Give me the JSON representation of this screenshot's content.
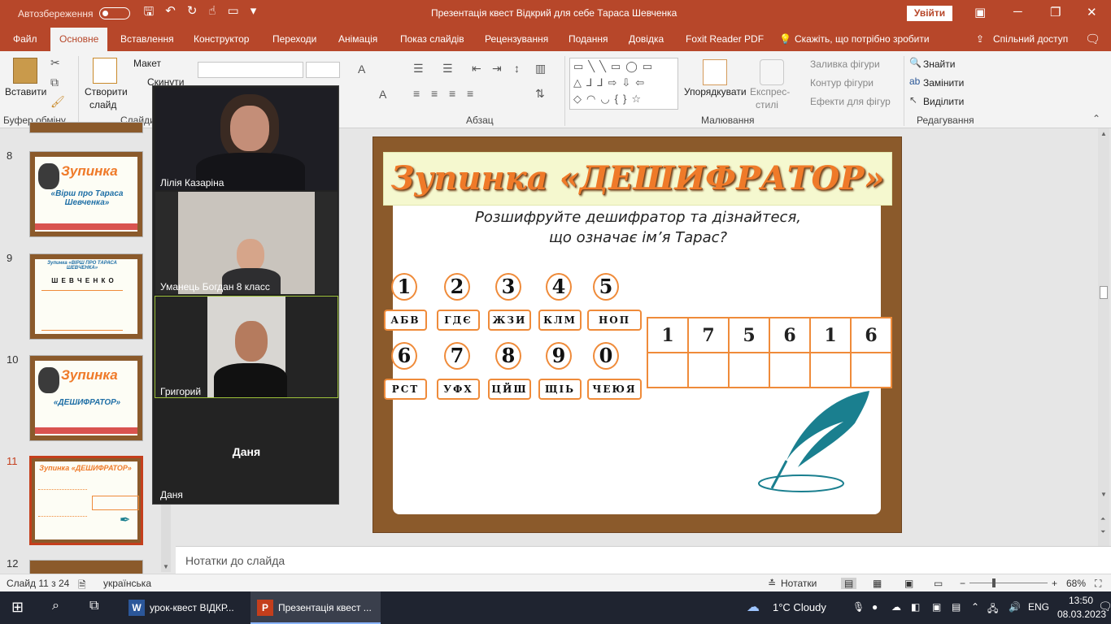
{
  "titlebar": {
    "autosave": "Автозбереження",
    "doc_title": "Презентація квест Відкрий для себе Тараса Шевченка",
    "login": "Увійти"
  },
  "tabs": [
    "Файл",
    "Основне",
    "Вставлення",
    "Конструктор",
    "Переходи",
    "Анімація",
    "Показ слайдів",
    "Рецензування",
    "Подання",
    "Довідка",
    "Foxit Reader PDF",
    "Скажіть, що потрібно зробити",
    "Спільний доступ"
  ],
  "ribbon": {
    "paste": "Вставити",
    "clipboard_group": "Буфер обміну",
    "new_slide_1": "Створити",
    "new_slide_2": "слайд",
    "layout": "Макет",
    "reset": "Скинути",
    "slides_group": "Слайди",
    "paragraph_group": "Абзац",
    "arrange": "Упорядкувати",
    "styles_1": "Експрес-",
    "styles_2": "стилі",
    "fill": "Заливка фігури",
    "outline": "Контур фігури",
    "effects": "Ефекти для фігур",
    "drawing_group": "Малювання",
    "find": "Знайти",
    "replace": "Замінити",
    "select": "Виділити",
    "editing_group": "Редагування"
  },
  "thumbnails": [
    {
      "num": "8",
      "line1": "Зупинка",
      "line2": "«Вірш про Тараса Шевченка»"
    },
    {
      "num": "9",
      "line1": "Зупинка «ВІРШ ПРО ТАРАСА ШЕВЧЕНКА»",
      "line2": "Ш Е В Ч Е Н К О"
    },
    {
      "num": "10",
      "line1": "Зупинка",
      "line2": "«ДЕШИФРАТОР»"
    },
    {
      "num": "11",
      "line1": "Зупинка «ДЕШИФРАТОР»",
      "line2": ""
    },
    {
      "num": "12",
      "line1": "",
      "line2": ""
    }
  ],
  "participants": [
    {
      "name": "Лілія Казаріна"
    },
    {
      "name": "Уманець Богдан 8 класс"
    },
    {
      "name": "Григорий"
    },
    {
      "name": "Даня",
      "center": "Даня"
    }
  ],
  "slide": {
    "title": "Зупинка «ДЕШИФРАТОР»",
    "subtitle_1": "Розшифруйте дешифратор та дізнайтеся,",
    "subtitle_2": "що означає ім’я Тарас?",
    "keys": [
      {
        "digit": "1",
        "letters": "АБВ"
      },
      {
        "digit": "2",
        "letters": "ГДЄ"
      },
      {
        "digit": "3",
        "letters": "ЖЗИ"
      },
      {
        "digit": "4",
        "letters": "КЛМ"
      },
      {
        "digit": "5",
        "letters": "НОП"
      },
      {
        "digit": "6",
        "letters": "РСТ"
      },
      {
        "digit": "7",
        "letters": "УФХ"
      },
      {
        "digit": "8",
        "letters": "ЦЙШ"
      },
      {
        "digit": "9",
        "letters": "ЩІЬ"
      },
      {
        "digit": "0",
        "letters": "ЧЕЮЯ"
      }
    ],
    "code": [
      "1",
      "7",
      "5",
      "6",
      "1",
      "6"
    ]
  },
  "notes_placeholder": "Нотатки до слайда",
  "status": {
    "slide_counter": "Слайд 11 з 24",
    "language": "українська",
    "notes": "Нотатки",
    "zoom": "68%"
  },
  "taskbar": {
    "app_word": "урок-квест ВІДКР...",
    "app_ppt": "Презентація квест ...",
    "weather": "1°C  Cloudy",
    "lang": "ENG",
    "time": "13:50",
    "date": "08.03.2023"
  },
  "colors": {
    "accent": "#b7472a",
    "orange": "#ef8b3a",
    "wood": "#8b5a2b"
  }
}
